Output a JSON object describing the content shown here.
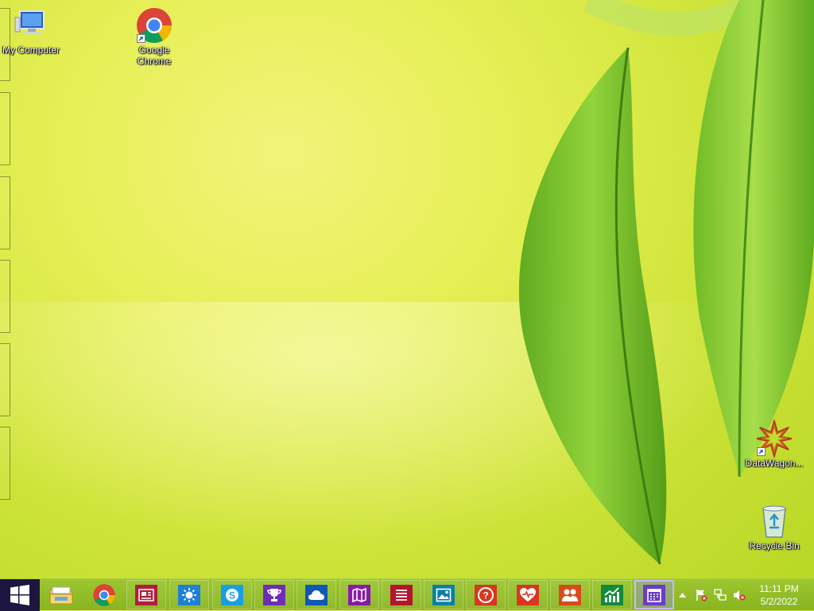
{
  "desktop": {
    "icons": [
      {
        "label": "My Computer"
      },
      {
        "label": "Google Chrome"
      },
      {
        "label": "DataWagon..."
      },
      {
        "label": "Recycle Bin"
      }
    ]
  },
  "taskbar": {
    "start_icon": "windows-logo-icon",
    "buttons": [
      {
        "name": "file-explorer",
        "icon": "folder-icon",
        "color": ""
      },
      {
        "name": "chrome",
        "icon": "chrome-icon",
        "color": ""
      },
      {
        "name": "news",
        "icon": "news-icon",
        "color": "#b01e3b"
      },
      {
        "name": "weather",
        "icon": "weather-sun-icon",
        "color": "#1f7fd6"
      },
      {
        "name": "skype",
        "icon": "skype-icon",
        "color": "#1a9ee0"
      },
      {
        "name": "sports",
        "icon": "trophy-icon",
        "color": "#6f2db4"
      },
      {
        "name": "onedrive",
        "icon": "cloud-icon",
        "color": "#0f58b3"
      },
      {
        "name": "maps",
        "icon": "map-icon",
        "color": "#8a1aa8"
      },
      {
        "name": "reading-list",
        "icon": "reading-list-icon",
        "color": "#b3162b"
      },
      {
        "name": "photos",
        "icon": "photos-icon",
        "color": "#0a7fa6"
      },
      {
        "name": "help-tips",
        "icon": "help-icon",
        "color": "#d9361f"
      },
      {
        "name": "health-fitness",
        "icon": "heart-icon",
        "color": "#d9361f"
      },
      {
        "name": "people",
        "icon": "people-icon",
        "color": "#d84a1b"
      },
      {
        "name": "finance",
        "icon": "finance-chart-icon",
        "color": "#128a3b"
      },
      {
        "name": "calendar",
        "icon": "calendar-icon",
        "color": "#6b3cc4"
      }
    ],
    "tray": {
      "icons": [
        "show-hidden-icons-chevron",
        "action-center-flag-icon",
        "network-icon",
        "volume-muted-icon"
      ],
      "time": "11:11 PM",
      "date": "5/2/2022"
    }
  },
  "colors": {
    "taskbar": "#8fba26",
    "start": "#1c1640",
    "active_border": "#c8b8ff"
  }
}
